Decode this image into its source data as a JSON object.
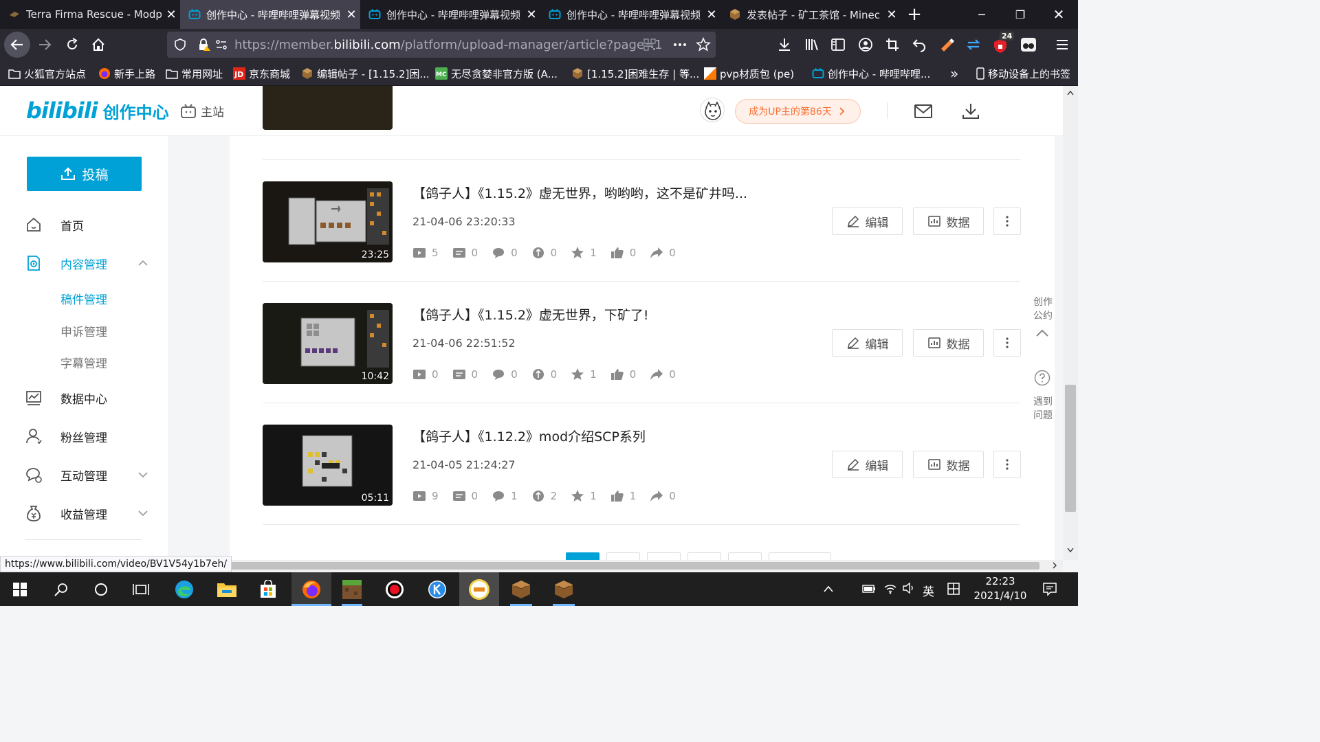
{
  "browser": {
    "tabs": [
      {
        "title": "Terra Firma Rescue - Modp",
        "icon": "web-icon",
        "active": false
      },
      {
        "title": "创作中心 - 哔哩哔哩弹幕视频",
        "icon": "bilibili-tv-icon",
        "active": true
      },
      {
        "title": "创作中心 - 哔哩哔哩弹幕视频",
        "icon": "bilibili-tv-icon",
        "active": false
      },
      {
        "title": "创作中心 - 哔哩哔哩弹幕视频",
        "icon": "bilibili-tv-icon",
        "active": false
      },
      {
        "title": "发表帖子 - 矿工茶馆 - Minec",
        "icon": "minecraft-block-icon",
        "active": false
      }
    ],
    "url_prefix": "https://member.",
    "url_domain": "bilibili.com",
    "url_path": "/platform/upload-manager/article?page=1",
    "extension_badge": "24",
    "bookmarks": [
      {
        "label": "火狐官方站点",
        "icon": "folder-icon"
      },
      {
        "label": "新手上路",
        "icon": "firefox-icon"
      },
      {
        "label": "常用网址",
        "icon": "folder-icon"
      },
      {
        "label": "京东商城",
        "icon": "jd-icon"
      },
      {
        "label": "编辑帖子 - [1.15.2]困...",
        "icon": "minecraft-block-icon"
      },
      {
        "label": "无尽贪婪非官方版 (A...",
        "icon": "mc-icon"
      },
      {
        "label": "[1.15.2]困难生存 | 等...",
        "icon": "minecraft-block-icon"
      },
      {
        "label": "pvp材质包 (pe)",
        "icon": "pvp-icon"
      },
      {
        "label": "创作中心 - 哔哩哔哩...",
        "icon": "bilibili-tv-icon"
      }
    ],
    "bookmarks_overflow": "»",
    "mobile_bookmarks": "移动设备上的书签",
    "status_url": "https://www.bilibili.com/video/BV1V54y1b7eh/"
  },
  "header": {
    "logo_main": "bilibili",
    "logo_sub": "创作中心",
    "main_site": "主站",
    "up_badge": "成为UP主的第86天"
  },
  "sidebar": {
    "upload_label": "投稿",
    "menu": [
      {
        "label": "首页",
        "icon": "home-icon"
      },
      {
        "label": "内容管理",
        "icon": "content-icon",
        "open": true
      },
      {
        "label": "数据中心",
        "icon": "chart-icon"
      },
      {
        "label": "粉丝管理",
        "icon": "fans-icon"
      },
      {
        "label": "互动管理",
        "icon": "interaction-icon"
      },
      {
        "label": "收益管理",
        "icon": "money-icon"
      }
    ],
    "submenu": [
      {
        "label": "稿件管理",
        "active": true
      },
      {
        "label": "申诉管理",
        "active": false
      },
      {
        "label": "字幕管理",
        "active": false
      }
    ]
  },
  "videos": [
    {
      "title": "【鸽子人】《1.15.2》虚无世界，哟哟哟，这不是矿井吗...",
      "time": "21-04-06 23:20:33",
      "duration": "23:25",
      "stats": {
        "plays": "5",
        "danmaku": "0",
        "comments": "0",
        "coins": "0",
        "favorites": "1",
        "likes": "0",
        "shares": "0"
      }
    },
    {
      "title": "【鸽子人】《1.15.2》虚无世界，下矿了!",
      "time": "21-04-06 22:51:52",
      "duration": "10:42",
      "stats": {
        "plays": "0",
        "danmaku": "0",
        "comments": "0",
        "coins": "0",
        "favorites": "1",
        "likes": "0",
        "shares": "0"
      }
    },
    {
      "title": "【鸽子人】《1.12.2》mod介绍SCP系列",
      "time": "21-04-05 21:24:27",
      "duration": "05:11",
      "stats": {
        "plays": "9",
        "danmaku": "0",
        "comments": "1",
        "coins": "2",
        "favorites": "1",
        "likes": "1",
        "shares": "0"
      }
    }
  ],
  "actions": {
    "edit": "编辑",
    "data": "数据"
  },
  "float": {
    "pledge": "创作\n公约",
    "help": "遇到\n问题"
  },
  "taskbar": {
    "ime_lang": "英",
    "time": "22:23",
    "date": "2021/4/10"
  },
  "colors": {
    "accent": "#00a1d6",
    "badge": "#f86f35"
  }
}
